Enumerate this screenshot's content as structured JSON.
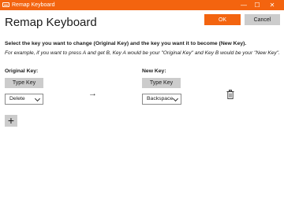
{
  "window": {
    "title": "Remap Keyboard",
    "minimize_glyph": "—",
    "maximize_glyph": "☐",
    "close_glyph": "✕"
  },
  "header": {
    "title": "Remap Keyboard",
    "ok_label": "OK",
    "cancel_label": "Cancel"
  },
  "instructions": {
    "main": "Select the key you want to change (Original Key) and the key you want it to become (New Key).",
    "example": "For example, if you want to press A and get B, Key A would be your \"Original Key\" and Key B would be your \"New Key\"."
  },
  "original_key": {
    "header": "Original Key:",
    "type_key_label": "Type Key",
    "selected": "Delete"
  },
  "new_key": {
    "header": "New Key:",
    "type_key_label": "Type Key",
    "selected": "Backspace"
  },
  "row": {
    "arrow_glyph": "→"
  },
  "add_button": {
    "glyph": "+"
  },
  "colors": {
    "accent": "#f3640f",
    "button_gray": "#cccccc"
  },
  "icons": [
    "keyboard-app-icon",
    "arrow-right-icon",
    "trash-icon",
    "plus-icon"
  ]
}
